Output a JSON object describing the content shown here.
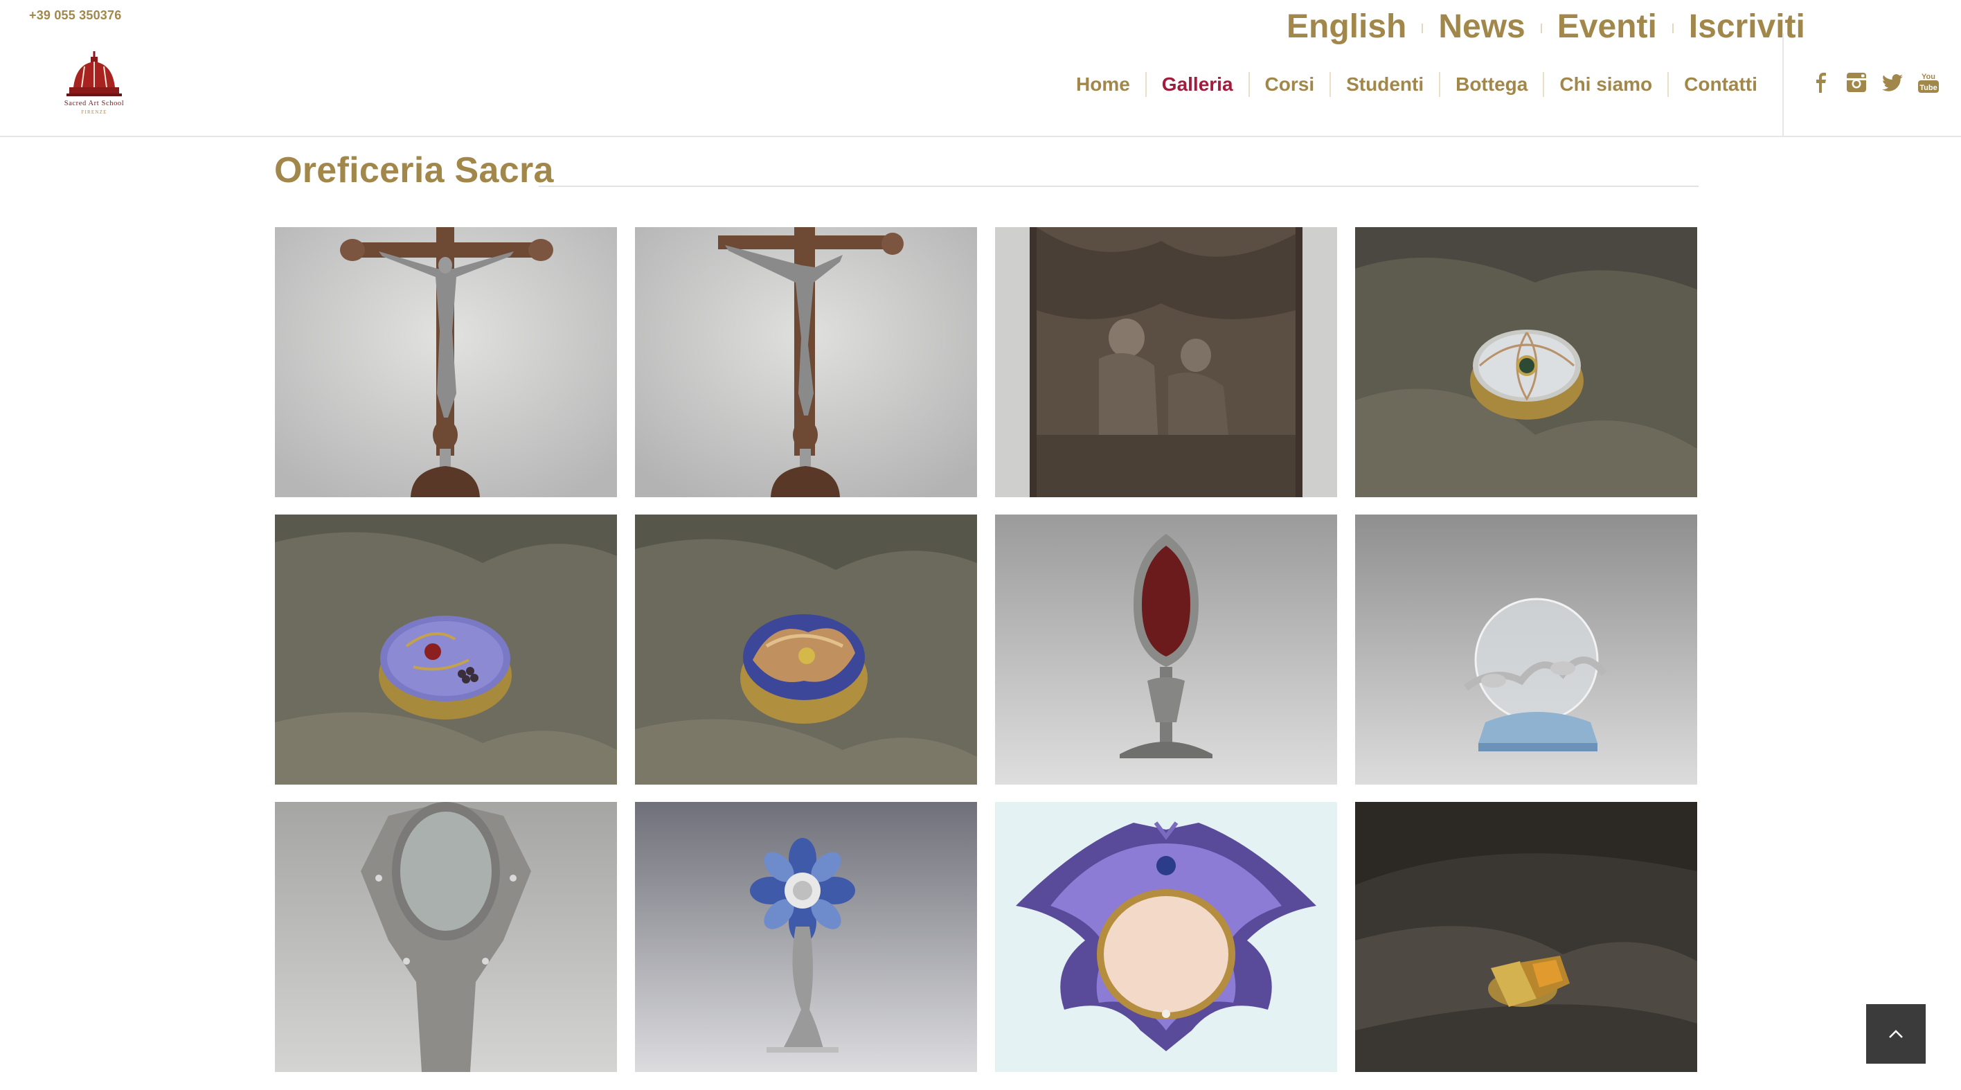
{
  "header": {
    "phone": "+39 055 350376",
    "logo": {
      "line1": "Sacred Art School",
      "line2": "FIRENZE",
      "icon": "dome-logo-icon"
    },
    "top_links": [
      "English",
      "News",
      "Eventi",
      "Iscriviti"
    ],
    "main_nav": [
      {
        "label": "Home",
        "active": false
      },
      {
        "label": "Galleria",
        "active": true
      },
      {
        "label": "Corsi",
        "active": false
      },
      {
        "label": "Studenti",
        "active": false
      },
      {
        "label": "Bottega",
        "active": false
      },
      {
        "label": "Chi siamo",
        "active": false
      },
      {
        "label": "Contatti",
        "active": false
      }
    ],
    "social": [
      "facebook-icon",
      "instagram-icon",
      "twitter-icon",
      "youtube-icon"
    ],
    "youtube_label": "You Tube"
  },
  "section": {
    "title": "Oreficeria Sacra"
  },
  "gallery": [
    "silver-crucifix-photo",
    "silver-crucifix-side-photo",
    "embossed-silver-relief-photo",
    "pearl-pyx-photo",
    "enamel-grapes-pyx-photo",
    "enamel-flame-pyx-photo",
    "red-relic-monstrance-photo",
    "crystal-sphere-reliquary-photo",
    "silver-mirror-reliquary-photo",
    "blue-flower-monstrance-photo",
    "winged-enamel-frame-photo",
    "gold-topaz-ring-photo"
  ],
  "colors": {
    "gold": "#a2874b",
    "active": "#a11c3d",
    "to_top": "#3b3b3b"
  },
  "back_to_top_icon": "chevron-up-icon"
}
